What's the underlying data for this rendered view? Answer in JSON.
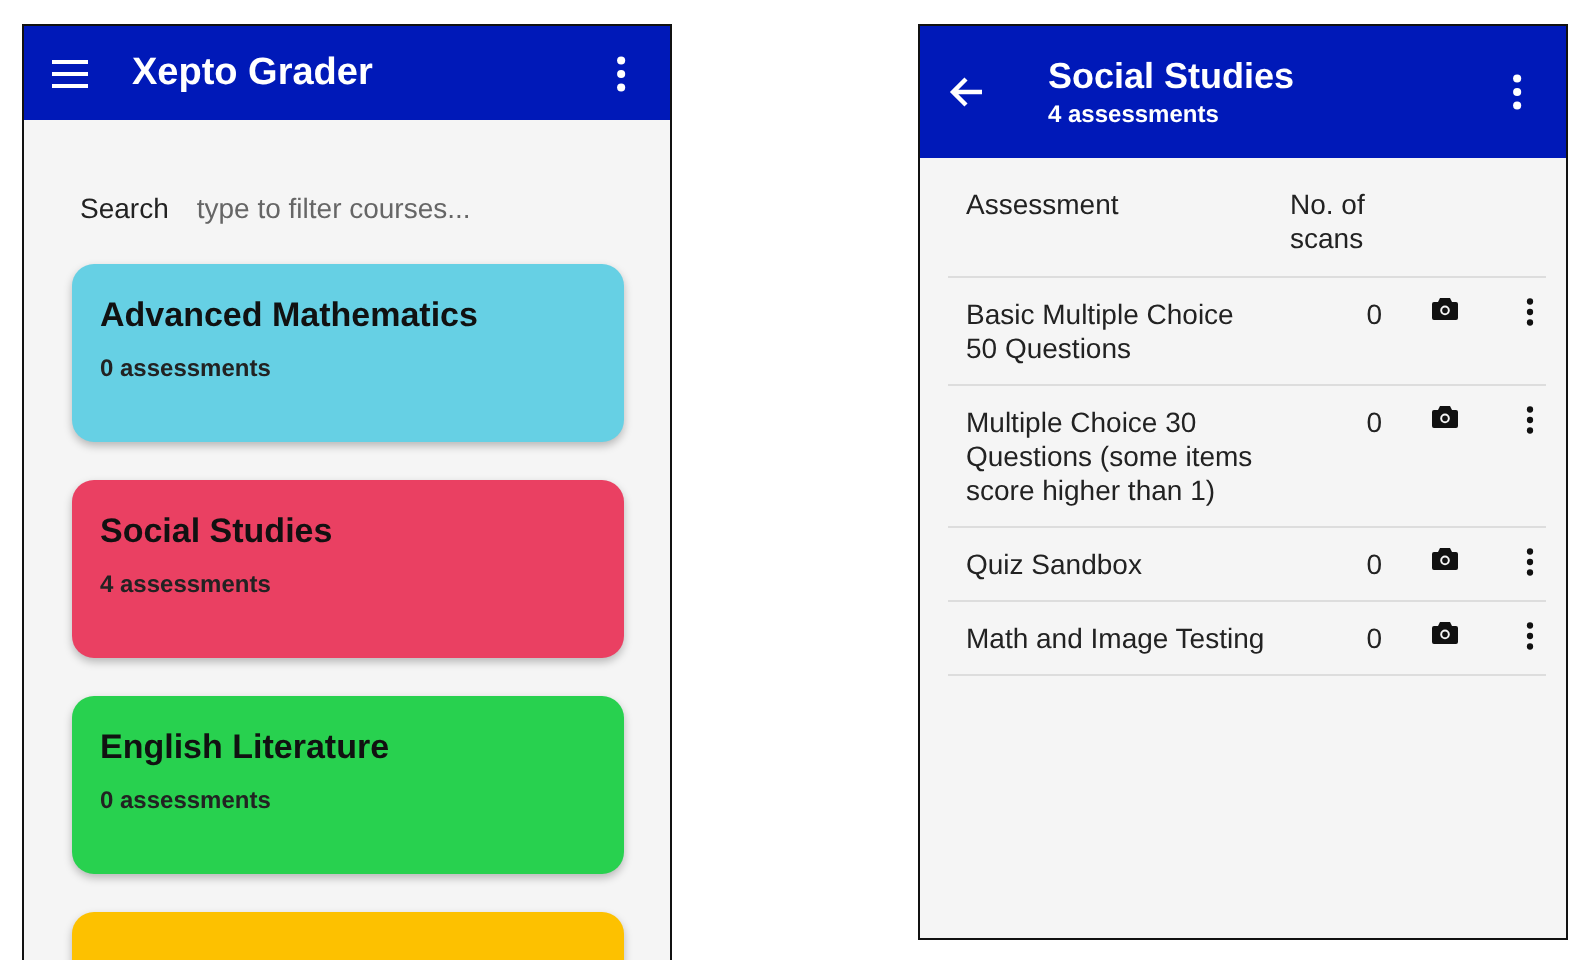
{
  "courses_screen": {
    "app_bar": {
      "title": "Xepto Grader"
    },
    "search": {
      "label": "Search",
      "placeholder": "type to filter courses..."
    },
    "courses": [
      {
        "name": "Advanced Mathematics",
        "count": "0 assessments",
        "color": "#66d0e4"
      },
      {
        "name": "Social Studies",
        "count": "4 assessments",
        "color": "#ea4062"
      },
      {
        "name": "English Literature",
        "count": "0 assessments",
        "color": "#28d14f"
      },
      {
        "color": "#fdc100"
      }
    ]
  },
  "course_screen": {
    "app_bar": {
      "title": "Social Studies",
      "subtitle": "4 assessments"
    },
    "table": {
      "columns": [
        "Assessment",
        "No. of scans"
      ],
      "rows": [
        {
          "name": "Basic Multiple Choice 50 Questions",
          "scans": "0"
        },
        {
          "name": "Multiple Choice 30 Questions (some items score higher than 1)",
          "scans": "0"
        },
        {
          "name": "Quiz Sandbox",
          "scans": "0"
        },
        {
          "name": "Math and Image Testing",
          "scans": "0"
        }
      ]
    }
  }
}
